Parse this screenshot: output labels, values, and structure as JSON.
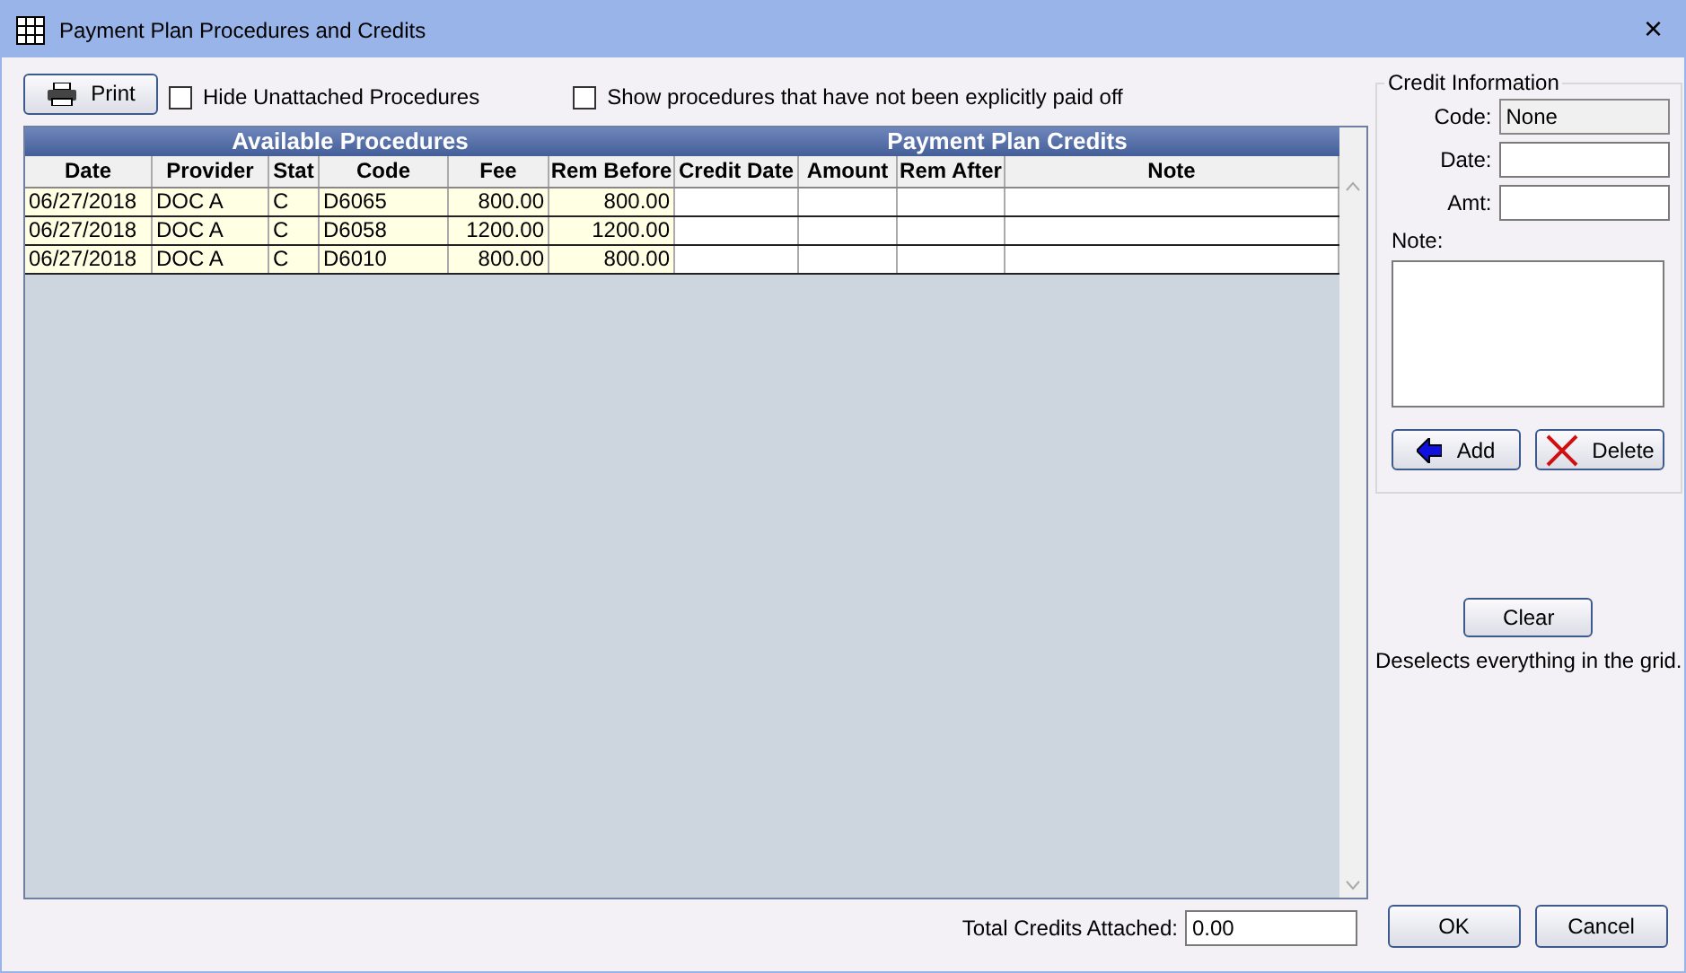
{
  "window": {
    "title": "Payment Plan Procedures and Credits",
    "close": "×"
  },
  "toolbar": {
    "print": "Print",
    "checkboxes": [
      {
        "label": "Hide Unattached Procedures",
        "checked": false
      },
      {
        "label": "Show procedures that have not been explicitly paid off",
        "checked": false
      }
    ]
  },
  "grid": {
    "bands": [
      "Available Procedures",
      "Payment Plan Credits"
    ],
    "columns": [
      "Date",
      "Provider",
      "Stat",
      "Code",
      "Fee",
      "Rem Before",
      "Credit Date",
      "Amount",
      "Rem After",
      "Note"
    ],
    "rows": [
      [
        "06/27/2018",
        "DOC A",
        "C",
        "D6065",
        "800.00",
        "800.00",
        "",
        "",
        "",
        ""
      ],
      [
        "06/27/2018",
        "DOC A",
        "C",
        "D6058",
        "1200.00",
        "1200.00",
        "",
        "",
        "",
        ""
      ],
      [
        "06/27/2018",
        "DOC A",
        "C",
        "D6010",
        "800.00",
        "800.00",
        "",
        "",
        "",
        ""
      ]
    ]
  },
  "credit_info": {
    "title": "Credit Information",
    "code_label": "Code:",
    "code_value": "None",
    "date_label": "Date:",
    "amt_label": "Amt:",
    "note_label": "Note:",
    "add": "Add",
    "delete": "Delete"
  },
  "clear": {
    "button": "Clear",
    "hint": "Deselects everything in the grid."
  },
  "total": {
    "label": "Total Credits Attached:",
    "value": "0.00"
  },
  "buttons": {
    "ok": "OK",
    "cancel": "Cancel"
  }
}
